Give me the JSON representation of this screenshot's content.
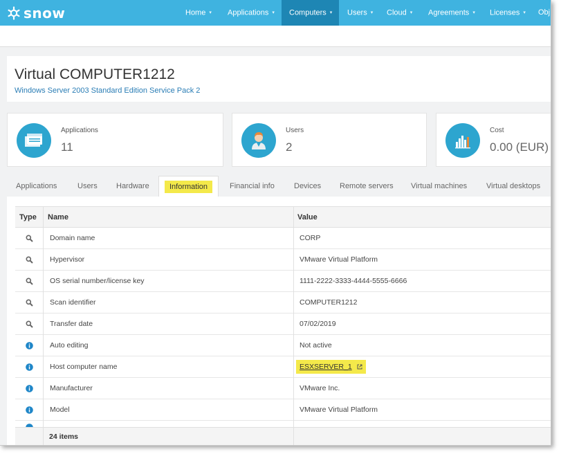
{
  "nav": {
    "brand": "snow",
    "items": [
      {
        "label": "Home"
      },
      {
        "label": "Applications"
      },
      {
        "label": "Computers"
      },
      {
        "label": "Users"
      },
      {
        "label": "Cloud"
      },
      {
        "label": "Agreements"
      },
      {
        "label": "Licenses"
      },
      {
        "label": "Obj"
      }
    ],
    "active": "Computers",
    "colors": {
      "bar": "#3fb3e0",
      "active": "#1e86b4"
    }
  },
  "header": {
    "title": "Virtual COMPUTER1212",
    "subtitle": "Windows Server 2003 Standard Edition Service Pack 2"
  },
  "cards": [
    {
      "label": "Applications",
      "value": "11",
      "icon": "application-window-icon"
    },
    {
      "label": "Users",
      "value": "2",
      "icon": "user-icon"
    },
    {
      "label": "Cost",
      "value": "0.00 (EUR)",
      "icon": "bar-chart-icon"
    }
  ],
  "tabs": [
    {
      "label": "Applications"
    },
    {
      "label": "Users"
    },
    {
      "label": "Hardware"
    },
    {
      "label": "Information"
    },
    {
      "label": "Financial info"
    },
    {
      "label": "Devices"
    },
    {
      "label": "Remote servers"
    },
    {
      "label": "Virtual machines"
    },
    {
      "label": "Virtual desktops"
    }
  ],
  "active_tab": "Information",
  "grid": {
    "columns": [
      "Type",
      "Name",
      "Value"
    ],
    "rows": [
      {
        "type": "search-icon",
        "name": "Domain name",
        "value": "CORP"
      },
      {
        "type": "search-icon",
        "name": "Hypervisor",
        "value": "VMware Virtual Platform"
      },
      {
        "type": "search-icon",
        "name": "OS serial number/license key",
        "value": "1111-2222-3333-4444-5555-6666"
      },
      {
        "type": "search-icon",
        "name": "Scan identifier",
        "value": "COMPUTER1212"
      },
      {
        "type": "search-icon",
        "name": "Transfer date",
        "value": "07/02/2019"
      },
      {
        "type": "info-icon",
        "name": "Auto editing",
        "value": "Not active"
      },
      {
        "type": "info-icon",
        "name": "Host computer name",
        "value": "ESXSERVER_1",
        "link": true
      },
      {
        "type": "info-icon",
        "name": "Manufacturer",
        "value": "VMware Inc."
      },
      {
        "type": "info-icon",
        "name": "Model",
        "value": "VMware Virtual Platform"
      }
    ],
    "footer": "24 items"
  },
  "highlight_color": "#f4e94a"
}
